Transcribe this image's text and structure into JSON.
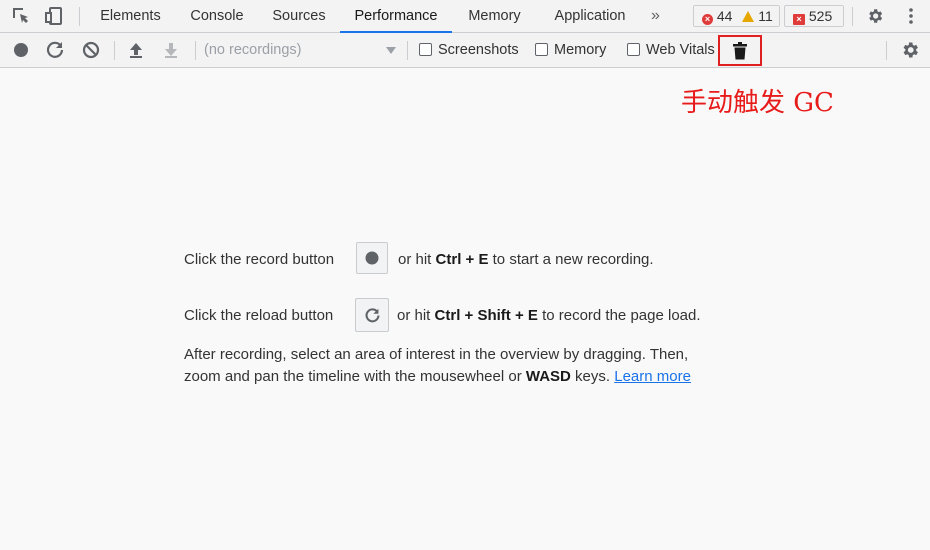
{
  "tabs": [
    "Elements",
    "Console",
    "Sources",
    "Performance",
    "Memory",
    "Application"
  ],
  "active_tab": "Performance",
  "more_tabs_glyph": "»",
  "counters": {
    "errors": "44",
    "warnings": "11",
    "issues": "525"
  },
  "toolbar": {
    "recordings_placeholder": "(no recordings)",
    "screenshots_label": "Screenshots",
    "memory_label": "Memory",
    "web_vitals_label": "Web Vitals"
  },
  "annotation": "手动触发 GC",
  "landing": {
    "record_pre": "Click the record button",
    "record_mid": "or hit",
    "record_key": "Ctrl + E",
    "record_post": "to start a new recording.",
    "reload_pre": "Click the reload button",
    "reload_mid": "or hit",
    "reload_key": "Ctrl + Shift + E",
    "reload_post": "to record the page load.",
    "after_line1": "After recording, select an area of interest in the overview by dragging. Then,",
    "after_line2_pre": "zoom and pan the timeline with the mousewheel or",
    "after_key": "WASD",
    "after_line2_post": "keys.",
    "learn_more": "Learn more"
  },
  "colors": {
    "accent": "#1a73e8",
    "error": "#e03b3b",
    "warning": "#e6a700",
    "annotation": "#e81b1b"
  }
}
